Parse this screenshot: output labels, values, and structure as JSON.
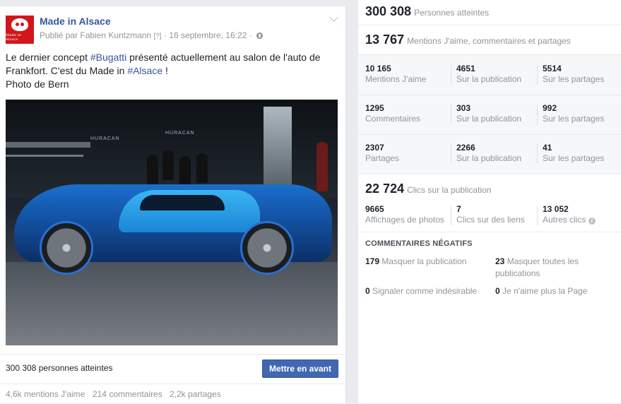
{
  "post": {
    "page_name": "Made in Alsace",
    "avatar_text": "Made in Alsace",
    "published_by": "Publié par Fabien Kuntzmann",
    "help_mark": "[?]",
    "date": "16 septembre, 16:22",
    "separator": "·",
    "text_part1": "Le dernier concept ",
    "hashtag1": "#Bugatti",
    "text_part2": " présenté actuellement au salon de l'auto de Frankfort. C'est du Made in ",
    "hashtag2": "#Alsace",
    "text_part3": " !",
    "text_line3": "Photo de Bern",
    "photo_signs": [
      "HURACAN",
      "HURACAN"
    ],
    "reach_text": "300 308 personnes atteintes",
    "boost_button": "Mettre en avant",
    "footer": {
      "likes": "4,6k mentions J'aime",
      "comments": "214 commentaires",
      "shares": "2,2k partages"
    }
  },
  "insights": {
    "reach": {
      "value": "300 308",
      "label": "Personnes atteintes"
    },
    "engagement": {
      "value": "13 767",
      "label": "Mentions J'aime, commentaires et partages"
    },
    "stats": [
      [
        {
          "num": "10 165",
          "lbl": "Mentions J'aime"
        },
        {
          "num": "4651",
          "lbl": "Sur la publication"
        },
        {
          "num": "5514",
          "lbl": "Sur les partages"
        }
      ],
      [
        {
          "num": "1295",
          "lbl": "Commentaires"
        },
        {
          "num": "303",
          "lbl": "Sur la publication"
        },
        {
          "num": "992",
          "lbl": "Sur les partages"
        }
      ],
      [
        {
          "num": "2307",
          "lbl": "Partages"
        },
        {
          "num": "2266",
          "lbl": "Sur la publication"
        },
        {
          "num": "41",
          "lbl": "Sur les partages"
        }
      ]
    ],
    "clicks": {
      "value": "22 724",
      "label": "Clics sur la publication"
    },
    "click_stats": [
      {
        "num": "9665",
        "lbl": "Affichages de photos"
      },
      {
        "num": "7",
        "lbl": "Clics sur des liens"
      },
      {
        "num": "13 052",
        "lbl": "Autres clics"
      }
    ],
    "negative": {
      "title": "COMMENTAIRES NÉGATIFS",
      "hide_post": {
        "num": "179",
        "lbl": "Masquer la publication"
      },
      "hide_all": {
        "num": "23",
        "lbl": "Masquer toutes les publications"
      },
      "spam": {
        "num": "0",
        "lbl": "Signaler comme indésirable"
      },
      "unlike": {
        "num": "0",
        "lbl": "Je n'aime plus la Page"
      }
    }
  }
}
